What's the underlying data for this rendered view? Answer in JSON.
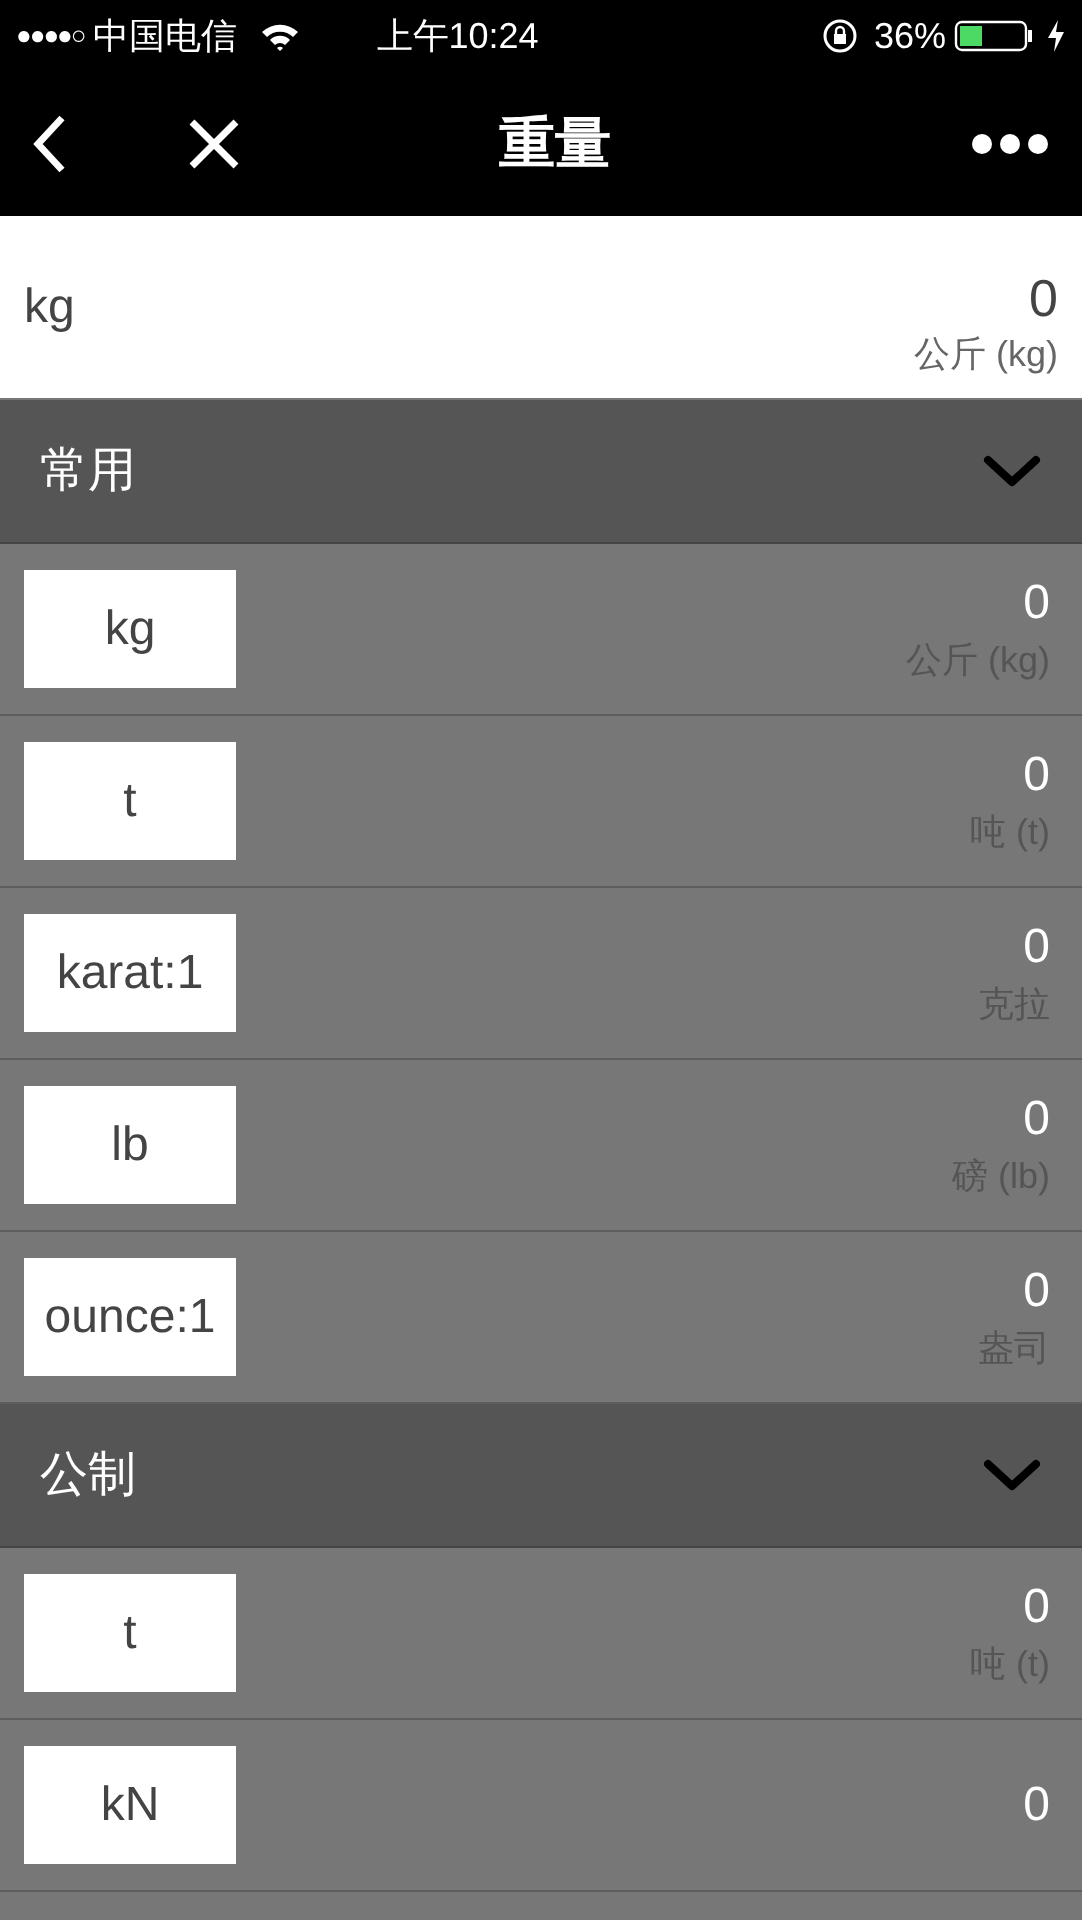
{
  "status_bar": {
    "signal": "●●●●○",
    "carrier": "中国电信",
    "time": "上午10:24",
    "battery_text": "36%"
  },
  "nav": {
    "title": "重量"
  },
  "current": {
    "unit": "kg",
    "value": "0",
    "name": "公斤 (kg)"
  },
  "sections": [
    {
      "title": "常用",
      "expanded": true,
      "rows": [
        {
          "unit": "kg",
          "value": "0",
          "name": "公斤 (kg)"
        },
        {
          "unit": "t",
          "value": "0",
          "name": "吨 (t)"
        },
        {
          "unit": "karat:1",
          "value": "0",
          "name": "克拉"
        },
        {
          "unit": "lb",
          "value": "0",
          "name": "磅 (lb)"
        },
        {
          "unit": "ounce:1",
          "value": "0",
          "name": "盎司"
        }
      ]
    },
    {
      "title": "公制",
      "expanded": true,
      "rows": [
        {
          "unit": "t",
          "value": "0",
          "name": "吨 (t)"
        },
        {
          "unit": "kN",
          "value": "0"
        }
      ]
    }
  ]
}
